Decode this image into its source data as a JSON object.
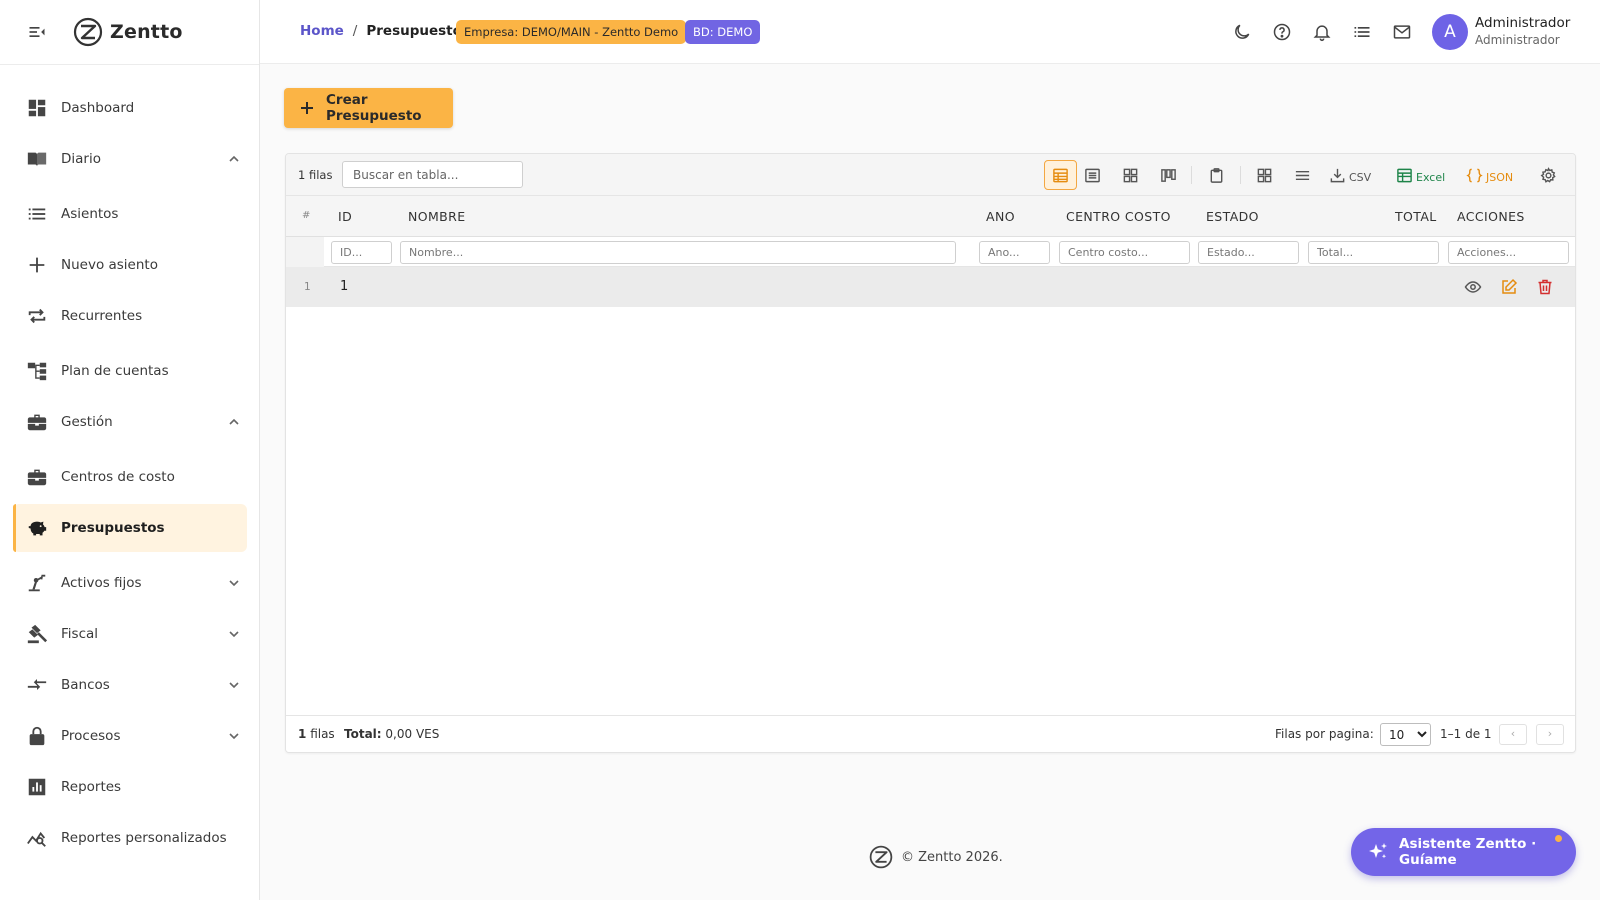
{
  "app": {
    "name": "Zentto",
    "accent": "#fbb445",
    "primary": "#7165e3"
  },
  "sidebar": {
    "items": [
      {
        "label": "Dashboard",
        "icon": "dashboard-icon"
      },
      {
        "label": "Diario",
        "icon": "journal-icon",
        "expanded": true
      },
      {
        "label": "Asientos",
        "icon": "list-icon"
      },
      {
        "label": "Nuevo asiento",
        "icon": "plus-icon"
      },
      {
        "label": "Recurrentes",
        "icon": "repeat-icon"
      },
      {
        "label": "Plan de cuentas",
        "icon": "account-tree-icon"
      },
      {
        "label": "Gestión",
        "icon": "briefcase-icon",
        "expanded": true
      },
      {
        "label": "Centros de costo",
        "icon": "briefcase-icon"
      },
      {
        "label": "Presupuestos",
        "icon": "piggy-bank-icon",
        "active": true
      },
      {
        "label": "Activos fijos",
        "icon": "precision-tool-icon",
        "expanded": false
      },
      {
        "label": "Fiscal",
        "icon": "gavel-icon",
        "expanded": false
      },
      {
        "label": "Bancos",
        "icon": "compare-arrows-icon",
        "expanded": false
      },
      {
        "label": "Procesos",
        "icon": "lock-icon",
        "expanded": false
      },
      {
        "label": "Reportes",
        "icon": "bar-chart-icon"
      },
      {
        "label": "Reportes personalizados",
        "icon": "query-stats-icon"
      }
    ]
  },
  "topbar": {
    "breadcrumb": {
      "home": "Home",
      "separator": "/",
      "current": "Presupuestos"
    },
    "empresa_badge": "Empresa: DEMO/MAIN - Zentto Demo",
    "bd_badge": "BD: DEMO",
    "user": {
      "initial": "A",
      "name": "Administrador",
      "role": "Administrador"
    }
  },
  "main": {
    "create_button": "Crear Presupuesto",
    "grid": {
      "row_count_label": "1 filas",
      "search_placeholder": "Buscar en tabla...",
      "export_csv": "CSV",
      "export_excel": "Excel",
      "export_json": "JSON",
      "columns": [
        "#",
        "ID",
        "NOMBRE",
        "ANO",
        "CENTRO COSTO",
        "ESTADO",
        "TOTAL",
        "ACCIONES"
      ],
      "filters": {
        "id": "ID...",
        "nombre": "Nombre...",
        "ano": "Ano...",
        "centro": "Centro costo...",
        "estado": "Estado...",
        "total": "Total...",
        "acciones": "Acciones..."
      },
      "rows": [
        {
          "num": "1",
          "id": "1",
          "nombre": "",
          "ano": "",
          "centro": "",
          "estado": "",
          "total": ""
        }
      ],
      "footer": {
        "count_num": "1",
        "count_label": "filas",
        "total_label": "Total:",
        "total_value": "0,00 VES",
        "rows_per_page_label": "Filas por pagina:",
        "rows_per_page": "10",
        "range": "1–1 de 1",
        "prev": "‹",
        "next": "›"
      }
    }
  },
  "footer": {
    "copyright": "© Zentto 2026."
  },
  "assistant": {
    "label": "Asistente Zentto · Guíame"
  }
}
